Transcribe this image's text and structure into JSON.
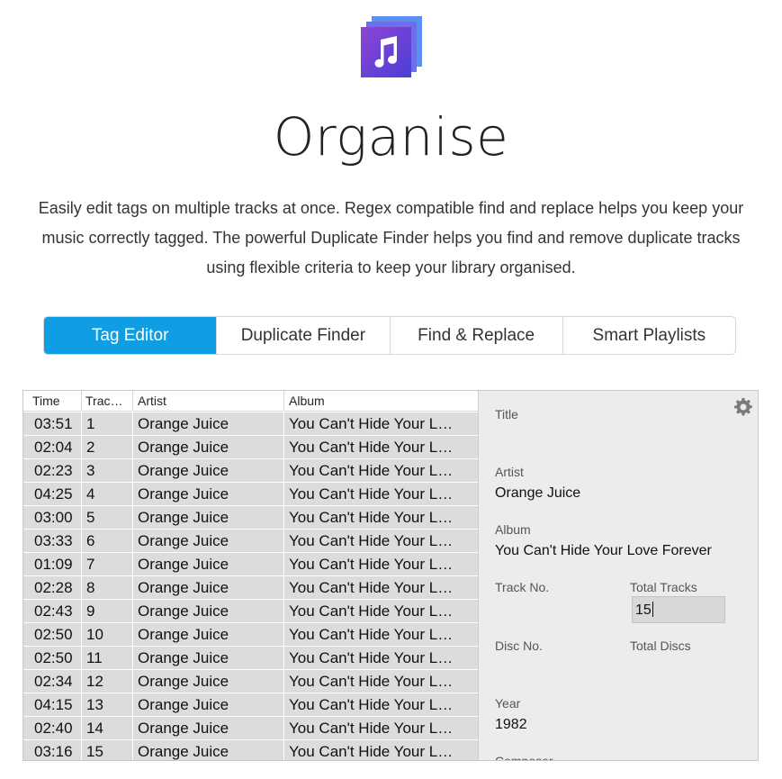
{
  "header": {
    "title": "Organise",
    "description": "Easily edit tags on multiple tracks at once. Regex compatible find and replace helps you keep your music correctly tagged. The powerful Duplicate Finder helps you find and remove duplicate tracks using flexible criteria to keep your library organised.",
    "logo_icon": "music-note-icon"
  },
  "tabs": [
    {
      "label": "Tag Editor",
      "active": true
    },
    {
      "label": "Duplicate Finder",
      "active": false
    },
    {
      "label": "Find & Replace",
      "active": false
    },
    {
      "label": "Smart Playlists",
      "active": false
    }
  ],
  "colors": {
    "accent": "#0f9de4",
    "row_bg": "#dcdcdc",
    "panel_bg": "#ececec"
  },
  "table": {
    "columns": [
      "Time",
      "Trac…",
      "Artist",
      "Album"
    ],
    "rows": [
      {
        "time": "03:51",
        "track": "1",
        "artist": "Orange Juice",
        "album": "You Can't Hide Your L…"
      },
      {
        "time": "02:04",
        "track": "2",
        "artist": "Orange Juice",
        "album": "You Can't Hide Your L…"
      },
      {
        "time": "02:23",
        "track": "3",
        "artist": "Orange Juice",
        "album": "You Can't Hide Your L…"
      },
      {
        "time": "04:25",
        "track": "4",
        "artist": "Orange Juice",
        "album": "You Can't Hide Your L…"
      },
      {
        "time": "03:00",
        "track": "5",
        "artist": "Orange Juice",
        "album": "You Can't Hide Your L…"
      },
      {
        "time": "03:33",
        "track": "6",
        "artist": "Orange Juice",
        "album": "You Can't Hide Your L…"
      },
      {
        "time": "01:09",
        "track": "7",
        "artist": "Orange Juice",
        "album": "You Can't Hide Your L…"
      },
      {
        "time": "02:28",
        "track": "8",
        "artist": "Orange Juice",
        "album": "You Can't Hide Your L…"
      },
      {
        "time": "02:43",
        "track": "9",
        "artist": "Orange Juice",
        "album": "You Can't Hide Your L…"
      },
      {
        "time": "02:50",
        "track": "10",
        "artist": "Orange Juice",
        "album": "You Can't Hide Your L…"
      },
      {
        "time": "02:50",
        "track": "11",
        "artist": "Orange Juice",
        "album": "You Can't Hide Your L…"
      },
      {
        "time": "02:34",
        "track": "12",
        "artist": "Orange Juice",
        "album": "You Can't Hide Your L…"
      },
      {
        "time": "04:15",
        "track": "13",
        "artist": "Orange Juice",
        "album": "You Can't Hide Your L…"
      },
      {
        "time": "02:40",
        "track": "14",
        "artist": "Orange Juice",
        "album": "You Can't Hide Your L…"
      },
      {
        "time": "03:16",
        "track": "15",
        "artist": "Orange Juice",
        "album": "You Can't Hide Your L…"
      }
    ]
  },
  "panel": {
    "gear_icon": "gear-icon",
    "title_label": "Title",
    "title_value": "",
    "artist_label": "Artist",
    "artist_value": "Orange Juice",
    "album_label": "Album",
    "album_value": "You Can't Hide Your Love Forever",
    "track_no_label": "Track No.",
    "total_tracks_label": "Total Tracks",
    "total_tracks_value": "15",
    "disc_no_label": "Disc No.",
    "total_discs_label": "Total Discs",
    "year_label": "Year",
    "year_value": "1982",
    "composer_label": "Composer"
  }
}
